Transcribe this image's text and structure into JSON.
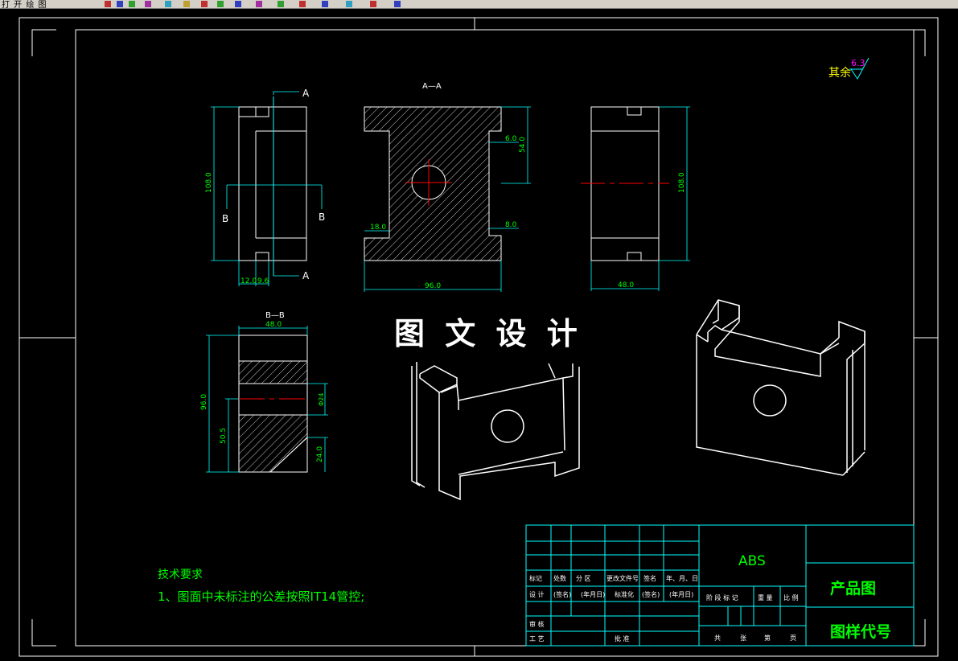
{
  "toolbar": {
    "menu_text": "打 开 绘 图",
    "icons": [
      "red-icon",
      "blue-icon",
      "green-icon",
      "magenta-icon",
      "cyan-icon",
      "yellow-icon",
      "red-icon",
      "green-icon",
      "blue-icon",
      "magenta-icon",
      "green-icon",
      "red-icon",
      "blue-icon",
      "cyan-icon",
      "red-icon",
      "blue-icon"
    ]
  },
  "colors": {
    "background": "#000000",
    "frame": "#ffffff",
    "geometry": "#ffffff",
    "dimension": "#00ff00",
    "dimension_line": "#00ffff",
    "centerline": "#ff0000",
    "hatch": "#ffffff",
    "title_block": "#00ffff",
    "text_green": "#00ff00",
    "roughness": "#ff00ff",
    "note_text": "#ffff00"
  },
  "drawing": {
    "roughness": {
      "label": "其余",
      "value": "6.3"
    },
    "views": {
      "section_aa_label": "A—A",
      "section_bb_label": "B—B",
      "cut_a": "A",
      "cut_b": "B"
    },
    "dims": {
      "front_height": "108.0",
      "front_w1": "12.0",
      "front_w2": "9.6",
      "aa_width": "96.0",
      "aa_6": "6.0",
      "aa_54": "54.0",
      "aa_18": "18.0",
      "aa_8": "8.0",
      "side_height": "108.0",
      "side_width": "48.0",
      "bb_width": "48.0",
      "bb_height": "96.0",
      "bb_505": "50.5",
      "bb_24": "24.0",
      "bb_dia": "Φ24"
    },
    "watermark": "图 文 设 计",
    "tech_req": {
      "title": "技术要求",
      "line1": "1、图面中未标注的公差按照IT14管控;"
    },
    "title_block": {
      "material": "ABS",
      "part_name": "产品图",
      "drawing_no": "图样代号",
      "row_marks": [
        "标记",
        "处数",
        "分 区",
        "更改文件号",
        "签名",
        "年、月、日"
      ],
      "row_design": [
        "设 计",
        "(签名)",
        "(年月日)",
        "标准化",
        "(签名)",
        "(年月日)"
      ],
      "row_stage": [
        "阶 段 标 记",
        "重 量",
        "比 例"
      ],
      "row_review": "审 核",
      "row_process": "工 艺",
      "row_approve": "批 准",
      "row_sheets": [
        "共",
        "张",
        "第",
        "页"
      ]
    }
  }
}
